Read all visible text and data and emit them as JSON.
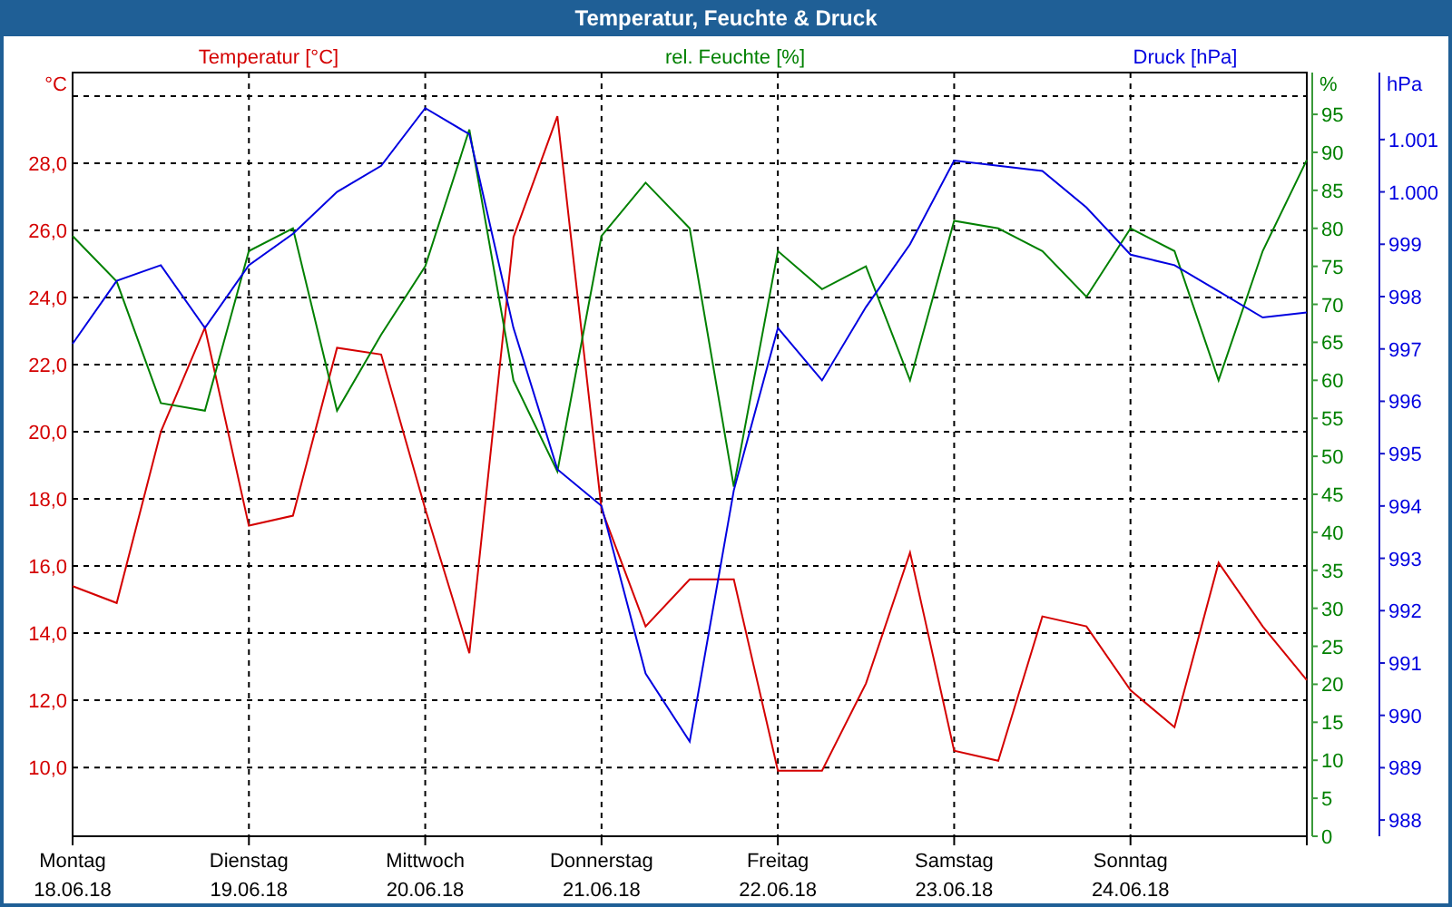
{
  "window": {
    "title": "Temperatur, Feuchte & Druck"
  },
  "chart": {
    "dates": [
      "18.06.18",
      "19.06.18",
      "20.06.18",
      "21.06.18",
      "22.06.18",
      "23.06.18",
      "24.06.18"
    ],
    "layers": [
      {
        "chart_data": {
          "type": "line",
          "ylabel": "°C",
          "grid": true,
          "ylim": [
            7.95,
            30.7
          ],
          "categories": [
            "Montag",
            null,
            null,
            null,
            "Dienstag",
            null,
            null,
            null,
            "Mittwoch",
            null,
            null,
            null,
            "Donnerstag",
            null,
            null,
            null,
            "Freitag",
            null,
            null,
            null,
            "Samstag",
            null,
            null,
            null,
            "Sonntag",
            null,
            null,
            null,
            null
          ],
          "yticks": [
            {
              "value": 10,
              "label": "10,0"
            },
            {
              "value": 12,
              "label": "12,0"
            },
            {
              "value": 14,
              "label": "14,0"
            },
            {
              "value": 16,
              "label": "16,0"
            },
            {
              "value": 18,
              "label": "18,0"
            },
            {
              "value": 20,
              "label": "20,0"
            },
            {
              "value": 22,
              "label": "22,0"
            },
            {
              "value": 24,
              "label": "24,0"
            },
            {
              "value": 26,
              "label": "26,0"
            },
            {
              "value": 28,
              "label": "28,0"
            }
          ],
          "series": [
            {
              "name": "Temperatur [°C]",
              "color": "#d40000",
              "values": [
                15.4,
                14.9,
                20.0,
                23.1,
                17.2,
                17.5,
                22.5,
                22.3,
                17.7,
                13.4,
                25.8,
                29.4,
                17.7,
                14.2,
                15.6,
                15.6,
                9.9,
                9.9,
                12.5,
                16.4,
                10.5,
                10.2,
                14.5,
                14.2,
                12.3,
                11.2,
                16.1,
                14.2,
                12.6
              ]
            }
          ]
        }
      },
      {
        "chart_data": {
          "type": "line",
          "ylabel": "%",
          "ylim": [
            0,
            100.5
          ],
          "categories": [
            null,
            null,
            null,
            null,
            null,
            null,
            null,
            null,
            null,
            null,
            null,
            null,
            null,
            null,
            null,
            null,
            null,
            null,
            null,
            null,
            null,
            null,
            null,
            null,
            null,
            null,
            null,
            null,
            null
          ],
          "yticks": [
            0,
            5,
            10,
            15,
            20,
            25,
            30,
            35,
            40,
            45,
            50,
            55,
            60,
            65,
            70,
            75,
            80,
            85,
            90,
            95
          ],
          "series": [
            {
              "name": "rel. Feuchte [%]",
              "color": "#008000",
              "values": [
                79,
                73,
                57,
                56,
                77,
                80,
                56,
                66,
                75,
                93,
                60,
                48,
                79,
                86,
                80,
                46,
                77,
                72,
                75,
                60,
                81,
                80,
                77,
                71,
                80,
                77,
                60,
                77,
                89
              ]
            }
          ]
        }
      },
      {
        "chart_data": {
          "type": "line",
          "ylabel": "hPa",
          "ylim": [
            987.69,
            1002.28
          ],
          "categories": [
            null,
            null,
            null,
            null,
            null,
            null,
            null,
            null,
            null,
            null,
            null,
            null,
            null,
            null,
            null,
            null,
            null,
            null,
            null,
            null,
            null,
            null,
            null,
            null,
            null,
            null,
            null,
            null,
            null
          ],
          "yticks": [
            988,
            989,
            990,
            991,
            992,
            993,
            994,
            995,
            996,
            997,
            998,
            999,
            {
              "value": 1000,
              "label": "1.000"
            },
            {
              "value": 1001,
              "label": "1.001"
            }
          ],
          "series": [
            {
              "name": "Druck [hPa]",
              "color": "#0000e0",
              "values": [
                997.1,
                998.3,
                998.6,
                997.4,
                998.6,
                999.2,
                1000.0,
                1000.5,
                1001.6,
                1001.1,
                997.4,
                994.7,
                994.0,
                990.8,
                989.5,
                994.3,
                997.4,
                996.4,
                997.8,
                999.0,
                1000.6,
                1000.5,
                1000.4,
                999.7,
                998.8,
                998.6,
                998.1,
                997.6,
                997.7
              ]
            }
          ]
        }
      }
    ]
  }
}
